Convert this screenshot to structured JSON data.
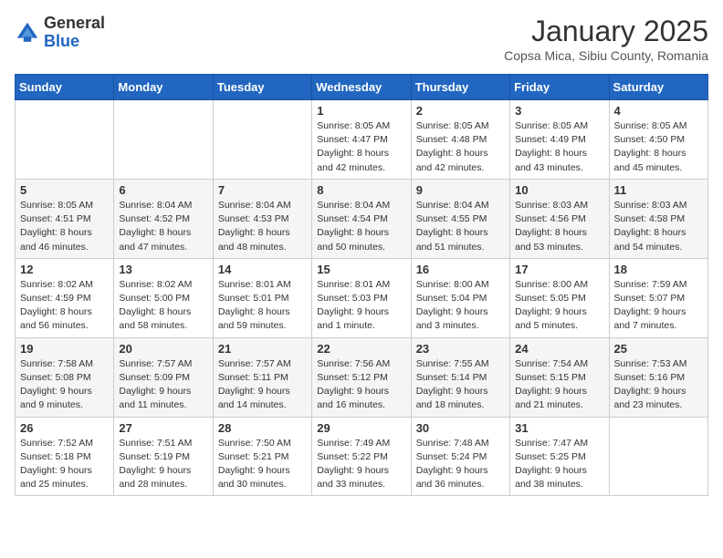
{
  "header": {
    "logo_general": "General",
    "logo_blue": "Blue",
    "month_title": "January 2025",
    "subtitle": "Copsa Mica, Sibiu County, Romania"
  },
  "weekdays": [
    "Sunday",
    "Monday",
    "Tuesday",
    "Wednesday",
    "Thursday",
    "Friday",
    "Saturday"
  ],
  "weeks": [
    [
      {
        "day": "",
        "info": ""
      },
      {
        "day": "",
        "info": ""
      },
      {
        "day": "",
        "info": ""
      },
      {
        "day": "1",
        "info": "Sunrise: 8:05 AM\nSunset: 4:47 PM\nDaylight: 8 hours and 42 minutes."
      },
      {
        "day": "2",
        "info": "Sunrise: 8:05 AM\nSunset: 4:48 PM\nDaylight: 8 hours and 42 minutes."
      },
      {
        "day": "3",
        "info": "Sunrise: 8:05 AM\nSunset: 4:49 PM\nDaylight: 8 hours and 43 minutes."
      },
      {
        "day": "4",
        "info": "Sunrise: 8:05 AM\nSunset: 4:50 PM\nDaylight: 8 hours and 45 minutes."
      }
    ],
    [
      {
        "day": "5",
        "info": "Sunrise: 8:05 AM\nSunset: 4:51 PM\nDaylight: 8 hours and 46 minutes."
      },
      {
        "day": "6",
        "info": "Sunrise: 8:04 AM\nSunset: 4:52 PM\nDaylight: 8 hours and 47 minutes."
      },
      {
        "day": "7",
        "info": "Sunrise: 8:04 AM\nSunset: 4:53 PM\nDaylight: 8 hours and 48 minutes."
      },
      {
        "day": "8",
        "info": "Sunrise: 8:04 AM\nSunset: 4:54 PM\nDaylight: 8 hours and 50 minutes."
      },
      {
        "day": "9",
        "info": "Sunrise: 8:04 AM\nSunset: 4:55 PM\nDaylight: 8 hours and 51 minutes."
      },
      {
        "day": "10",
        "info": "Sunrise: 8:03 AM\nSunset: 4:56 PM\nDaylight: 8 hours and 53 minutes."
      },
      {
        "day": "11",
        "info": "Sunrise: 8:03 AM\nSunset: 4:58 PM\nDaylight: 8 hours and 54 minutes."
      }
    ],
    [
      {
        "day": "12",
        "info": "Sunrise: 8:02 AM\nSunset: 4:59 PM\nDaylight: 8 hours and 56 minutes."
      },
      {
        "day": "13",
        "info": "Sunrise: 8:02 AM\nSunset: 5:00 PM\nDaylight: 8 hours and 58 minutes."
      },
      {
        "day": "14",
        "info": "Sunrise: 8:01 AM\nSunset: 5:01 PM\nDaylight: 8 hours and 59 minutes."
      },
      {
        "day": "15",
        "info": "Sunrise: 8:01 AM\nSunset: 5:03 PM\nDaylight: 9 hours and 1 minute."
      },
      {
        "day": "16",
        "info": "Sunrise: 8:00 AM\nSunset: 5:04 PM\nDaylight: 9 hours and 3 minutes."
      },
      {
        "day": "17",
        "info": "Sunrise: 8:00 AM\nSunset: 5:05 PM\nDaylight: 9 hours and 5 minutes."
      },
      {
        "day": "18",
        "info": "Sunrise: 7:59 AM\nSunset: 5:07 PM\nDaylight: 9 hours and 7 minutes."
      }
    ],
    [
      {
        "day": "19",
        "info": "Sunrise: 7:58 AM\nSunset: 5:08 PM\nDaylight: 9 hours and 9 minutes."
      },
      {
        "day": "20",
        "info": "Sunrise: 7:57 AM\nSunset: 5:09 PM\nDaylight: 9 hours and 11 minutes."
      },
      {
        "day": "21",
        "info": "Sunrise: 7:57 AM\nSunset: 5:11 PM\nDaylight: 9 hours and 14 minutes."
      },
      {
        "day": "22",
        "info": "Sunrise: 7:56 AM\nSunset: 5:12 PM\nDaylight: 9 hours and 16 minutes."
      },
      {
        "day": "23",
        "info": "Sunrise: 7:55 AM\nSunset: 5:14 PM\nDaylight: 9 hours and 18 minutes."
      },
      {
        "day": "24",
        "info": "Sunrise: 7:54 AM\nSunset: 5:15 PM\nDaylight: 9 hours and 21 minutes."
      },
      {
        "day": "25",
        "info": "Sunrise: 7:53 AM\nSunset: 5:16 PM\nDaylight: 9 hours and 23 minutes."
      }
    ],
    [
      {
        "day": "26",
        "info": "Sunrise: 7:52 AM\nSunset: 5:18 PM\nDaylight: 9 hours and 25 minutes."
      },
      {
        "day": "27",
        "info": "Sunrise: 7:51 AM\nSunset: 5:19 PM\nDaylight: 9 hours and 28 minutes."
      },
      {
        "day": "28",
        "info": "Sunrise: 7:50 AM\nSunset: 5:21 PM\nDaylight: 9 hours and 30 minutes."
      },
      {
        "day": "29",
        "info": "Sunrise: 7:49 AM\nSunset: 5:22 PM\nDaylight: 9 hours and 33 minutes."
      },
      {
        "day": "30",
        "info": "Sunrise: 7:48 AM\nSunset: 5:24 PM\nDaylight: 9 hours and 36 minutes."
      },
      {
        "day": "31",
        "info": "Sunrise: 7:47 AM\nSunset: 5:25 PM\nDaylight: 9 hours and 38 minutes."
      },
      {
        "day": "",
        "info": ""
      }
    ]
  ]
}
